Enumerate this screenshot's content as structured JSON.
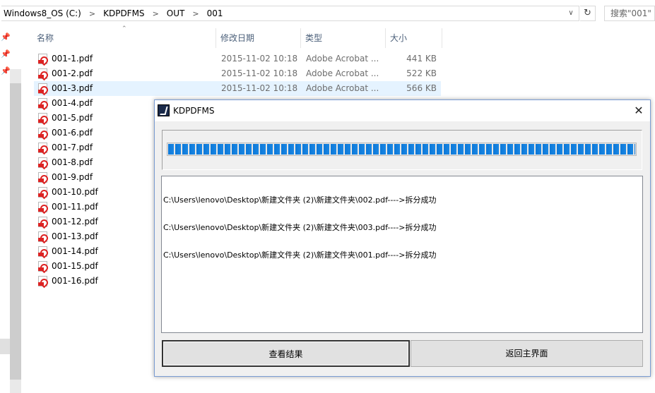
{
  "address": {
    "crumbs": [
      "Windows8_OS (C:)",
      "KDPDFMS",
      "OUT",
      "001"
    ],
    "separator": ">",
    "dropdown_icon": "chevron-down-icon",
    "refresh_icon": "refresh-icon",
    "search_placeholder": "搜索\"001\""
  },
  "columns": {
    "name": "名称",
    "date": "修改日期",
    "type": "类型",
    "size": "大小"
  },
  "files": [
    {
      "name": "001-1.pdf",
      "date": "2015-11-02 10:18",
      "type": "Adobe Acrobat ...",
      "size": "441 KB"
    },
    {
      "name": "001-2.pdf",
      "date": "2015-11-02 10:18",
      "type": "Adobe Acrobat ...",
      "size": "522 KB"
    },
    {
      "name": "001-3.pdf",
      "date": "2015-11-02 10:18",
      "type": "Adobe Acrobat ...",
      "size": "566 KB",
      "selected": true
    },
    {
      "name": "001-4.pdf",
      "date": "",
      "type": "",
      "size": ""
    },
    {
      "name": "001-5.pdf",
      "date": "",
      "type": "",
      "size": ""
    },
    {
      "name": "001-6.pdf",
      "date": "",
      "type": "",
      "size": ""
    },
    {
      "name": "001-7.pdf",
      "date": "",
      "type": "",
      "size": ""
    },
    {
      "name": "001-8.pdf",
      "date": "",
      "type": "",
      "size": ""
    },
    {
      "name": "001-9.pdf",
      "date": "",
      "type": "",
      "size": ""
    },
    {
      "name": "001-10.pdf",
      "date": "",
      "type": "",
      "size": ""
    },
    {
      "name": "001-11.pdf",
      "date": "",
      "type": "",
      "size": ""
    },
    {
      "name": "001-12.pdf",
      "date": "",
      "type": "",
      "size": ""
    },
    {
      "name": "001-13.pdf",
      "date": "",
      "type": "",
      "size": ""
    },
    {
      "name": "001-14.pdf",
      "date": "",
      "type": "",
      "size": ""
    },
    {
      "name": "001-15.pdf",
      "date": "",
      "type": "",
      "size": ""
    },
    {
      "name": "001-16.pdf",
      "date": "",
      "type": "",
      "size": ""
    }
  ],
  "dialog": {
    "title": "KDPDFMS",
    "close_icon": "close-icon",
    "progress_fraction": 1.0,
    "progress_color": "#1a87e3",
    "log_lines": [
      "C:\\Users\\lenovo\\Desktop\\新建文件夹 (2)\\新建文件夹\\002.pdf---->拆分成功",
      "C:\\Users\\lenovo\\Desktop\\新建文件夹 (2)\\新建文件夹\\003.pdf---->拆分成功",
      "C:\\Users\\lenovo\\Desktop\\新建文件夹 (2)\\新建文件夹\\001.pdf---->拆分成功"
    ],
    "view_results_label": "查看结果",
    "back_home_label": "返回主界面"
  }
}
